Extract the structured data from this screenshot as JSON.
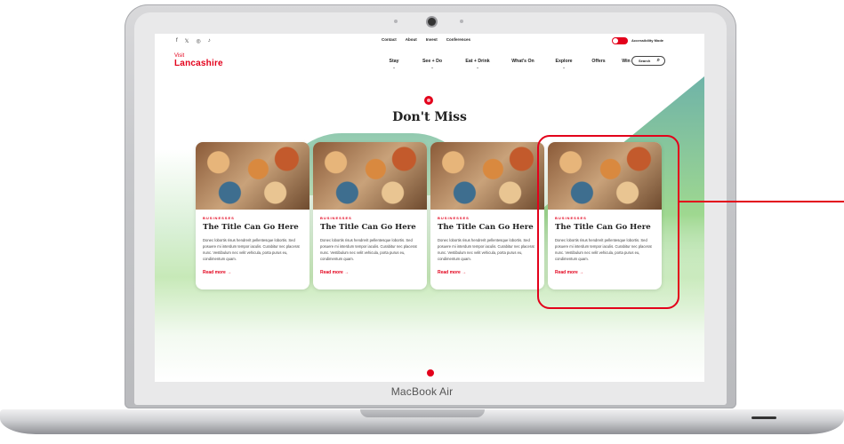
{
  "device": {
    "brand_label": "MacBook Air"
  },
  "topbar": {
    "social": [
      "f",
      "𝕏",
      "◎",
      "♪"
    ],
    "utility_links": [
      "Contact",
      "About",
      "Invest",
      "Conferences"
    ],
    "accessibility_label": "Accessibility Mode"
  },
  "header": {
    "logo_top": "Visit",
    "logo_main": "Lancashire",
    "nav": [
      {
        "label": "Stay",
        "has_chevron": true
      },
      {
        "label": "See + Do",
        "has_chevron": true
      },
      {
        "label": "Eat + Drink",
        "has_chevron": true
      },
      {
        "label": "What's On",
        "has_chevron": false
      },
      {
        "label": "Explore",
        "has_chevron": true
      },
      {
        "label": "Offers",
        "has_chevron": false
      },
      {
        "label": "Win",
        "has_chevron": false
      }
    ],
    "search_label": "Search"
  },
  "section": {
    "heading": "Don't Miss"
  },
  "cards": [
    {
      "category": "BUSINESSES",
      "title": "The Title Can Go Here",
      "text": "Donec lobortis risus hendrerit pellentesque lobortis. Sed posuere mi interdum tempor iaculis. Curabitur nec placerat nunc. Vestibulum nec velit vehicula, porta purus eu, condimentum quam.",
      "link": "Read more  →"
    },
    {
      "category": "BUSINESSES",
      "title": "The Title Can Go Here",
      "text": "Donec lobortis risus hendrerit pellentesque lobortis. Sed posuere mi interdum tempor iaculis. Curabitur nec placerat nunc. Vestibulum nec velit vehicula, porta purus eu, condimentum quam.",
      "link": "Read more  →"
    },
    {
      "category": "BUSINESSES",
      "title": "The Title Can Go Here",
      "text": "Donec lobortis risus hendrerit pellentesque lobortis. Sed posuere mi interdum tempor iaculis. Curabitur nec placerat nunc. Vestibulum nec velit vehicula, porta purus eu, condimentum quam.",
      "link": "Read more  →"
    },
    {
      "category": "BUSINESSES",
      "title": "The Title Can Go Here",
      "text": "Donec lobortis risus hendrerit pellentesque lobortis. Sed posuere mi interdum tempor iaculis. Curabitur nec placerat nunc. Vestibulum nec velit vehicula, porta purus eu, condimentum quam.",
      "link": "Read more  →"
    }
  ],
  "colors": {
    "brand_red": "#e3001b",
    "teal": "#6fb3a8",
    "green": "#9fd890"
  }
}
